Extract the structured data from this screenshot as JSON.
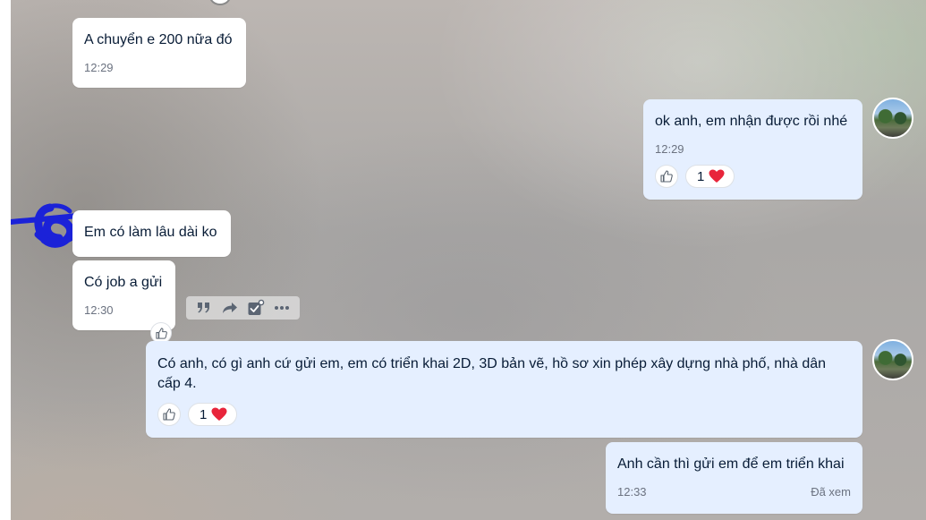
{
  "colors": {
    "incoming_bubble": "#ffffff",
    "outgoing_bubble": "#e5efff",
    "text": "#081c36",
    "heart": "#e8253b"
  },
  "messages": [
    {
      "id": "m1",
      "side": "incoming",
      "text": "A chuyển e 200 nữa đó",
      "time": "12:29"
    },
    {
      "id": "m2",
      "side": "outgoing",
      "text": "ok anh, em nhận được rồi nhé",
      "time": "12:29",
      "reaction": {
        "count": "1",
        "emoji": "heart-icon"
      }
    },
    {
      "id": "m3",
      "side": "incoming",
      "text": "Em có làm lâu dài ko"
    },
    {
      "id": "m4",
      "side": "incoming",
      "text": "Có job a gửi",
      "time": "12:30"
    },
    {
      "id": "m5",
      "side": "outgoing",
      "text": "Có anh, có gì anh cứ gửi em, em có triển khai 2D, 3D bản vẽ, hồ sơ xin phép xây dựng nhà phố, nhà dân cấp 4.",
      "reaction": {
        "count": "1",
        "emoji": "heart-icon"
      }
    },
    {
      "id": "m6",
      "side": "outgoing",
      "text": "Anh cần thì gửi em để em triển khai",
      "time": "12:33",
      "status": "Đã xem"
    }
  ],
  "hover_toolbar": {
    "icons": [
      "quote-icon",
      "forward-icon",
      "task-check-icon",
      "more-options-icon"
    ]
  }
}
